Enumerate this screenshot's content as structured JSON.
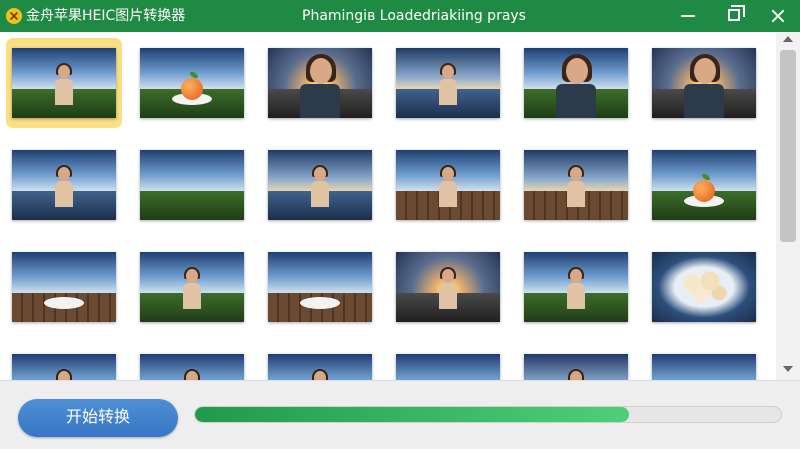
{
  "window": {
    "title": "金舟苹果HEIC图片转换器",
    "status": "Phamingів Loadedriakiing prays",
    "accent_color": "#1f8a43"
  },
  "controls": {
    "minimize_icon": "minimize-icon",
    "maximize_icon": "maximize-icon",
    "close_icon": "close-icon"
  },
  "thumbnails": [
    {
      "scene": "woman-grass",
      "selected": true
    },
    {
      "scene": "fruit-plate-grass",
      "selected": false
    },
    {
      "scene": "woman-portrait-sunset",
      "selected": false
    },
    {
      "scene": "woman-lake-dusk",
      "selected": false
    },
    {
      "scene": "woman-glasses-portrait",
      "selected": false
    },
    {
      "scene": "woman-portrait-sunset-2",
      "selected": false
    },
    {
      "scene": "woman-lake-shore",
      "selected": false
    },
    {
      "scene": "meadow-landscape",
      "selected": false
    },
    {
      "scene": "woman-leaf-lake",
      "selected": false
    },
    {
      "scene": "portrait-pier",
      "selected": false
    },
    {
      "scene": "woman-pier-plate",
      "selected": false
    },
    {
      "scene": "fruit-plate-grass-2",
      "selected": false
    },
    {
      "scene": "plate-pier",
      "selected": false
    },
    {
      "scene": "woman-lake-field",
      "selected": false
    },
    {
      "scene": "plate-pier-sky",
      "selected": false
    },
    {
      "scene": "silhouette-dock-sunset",
      "selected": false
    },
    {
      "scene": "woman-meadow",
      "selected": false
    },
    {
      "scene": "flowers-plate",
      "selected": false
    },
    {
      "scene": "woman-pier-small",
      "selected": false
    },
    {
      "scene": "woman-lake-small",
      "selected": false
    },
    {
      "scene": "woman-pier-sky",
      "selected": false
    },
    {
      "scene": "lake-landscape",
      "selected": false
    },
    {
      "scene": "woman-meadow-2",
      "selected": false
    },
    {
      "scene": "sky-landscape",
      "selected": false
    }
  ],
  "actions": {
    "start_label": "开始转换",
    "progress_percent": 74
  }
}
